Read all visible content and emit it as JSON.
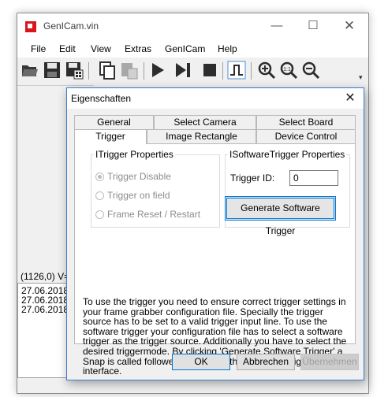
{
  "app": {
    "title": "GenICam.vin",
    "menu": [
      "File",
      "Edit",
      "View",
      "Extras",
      "GenICam",
      "Help"
    ],
    "toolbar_icons": [
      "open-icon",
      "save-icon",
      "save-as-icon",
      "copy-icon",
      "paste-icon",
      "play-icon",
      "step-icon",
      "stop-icon",
      "trigger-pulse-icon",
      "zoom-in-icon",
      "zoom-1to1-icon",
      "zoom-out-icon"
    ],
    "status_coords": "(1126,0) V=",
    "log_lines": [
      "27.06.2018",
      "27.06.2018",
      "27.06.2018"
    ]
  },
  "dialog": {
    "title": "Eigenschaften",
    "tabs_row1": [
      "General",
      "Select Camera",
      "Select Board"
    ],
    "tabs_row2": [
      "Trigger",
      "Image Rectangle",
      "Device Control"
    ],
    "active_tab": "Trigger",
    "itrigger": {
      "legend": "ITrigger Properties",
      "options": [
        "Trigger Disable",
        "Trigger on field",
        "Frame Reset / Restart"
      ],
      "selected": "Trigger Disable"
    },
    "isoftware": {
      "legend": "ISoftwareTrigger Properties",
      "trigger_id_label": "Trigger ID:",
      "trigger_id_value": "0",
      "generate_button": "Generate Software Trigger"
    },
    "help_text": "To use the trigger you need to ensure correct trigger settings in your frame grabber configuration file. Specially the trigger source has to be set to a valid trigger input line. To use the software trigger your configuration file has to select a software trigger as the trigger source. Additionally you have to select the desired triggermode. By clicking 'Generate Software Trigger' a Snap is called followed by a call to the ISoftwareTrigger interface.",
    "buttons": {
      "ok": "OK",
      "cancel": "Abbrechen",
      "apply": "Übernehmen"
    }
  },
  "colors": {
    "accent": "#0078d7",
    "logo": "#d9141a"
  }
}
